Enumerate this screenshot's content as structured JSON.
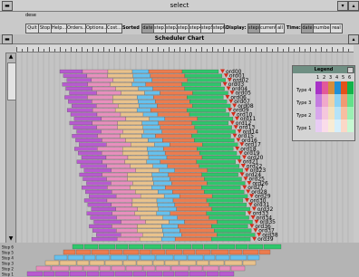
{
  "window": {
    "title": "select",
    "app_label": "dese"
  },
  "toolbar": {
    "buttons": [
      "Quit",
      "Stop",
      "Help...",
      "Orders...",
      "Options...",
      "Cost..."
    ],
    "sorted_by_label": "Sorted by:",
    "sort_options": [
      "date",
      "step1",
      "step2",
      "step3",
      "step4",
      "step5",
      "step6"
    ],
    "sort_selected": "date",
    "display_label": "Display:",
    "display_options": [
      "steps",
      "current",
      "all"
    ],
    "display_selected": "steps",
    "time_label": "Time:",
    "time_options": [
      "date",
      "number",
      "real"
    ],
    "time_selected": "date"
  },
  "chart_header": {
    "title": "Scheduler Chart"
  },
  "step_colors": [
    "#b85ad0",
    "#e88fbd",
    "#e9c28c",
    "#66c1ee",
    "#ec7c4e",
    "#2ec66b"
  ],
  "orders": {
    "labels": [
      "ord00",
      "ord01",
      "ord02",
      "ord03",
      "ord04",
      "ord05",
      "ord06",
      "ord07",
      "ord08",
      "ord09",
      "ord10",
      "ord11",
      "ord12",
      "ord13",
      "ord14",
      "ord15",
      "ord16",
      "ord17",
      "ord18",
      "ord19",
      "ord20",
      "ord21",
      "ord22",
      "ord23",
      "ord24",
      "ord25",
      "ord26",
      "ord27",
      "ord28",
      "ord29",
      "ord30",
      "ord31",
      "ord32",
      "ord33",
      "ord34",
      "ord35",
      "ord36",
      "ord37",
      "ord38",
      "ord39"
    ],
    "marker_color": "#d42a1a"
  },
  "legend": {
    "title": "Legend",
    "columns": [
      "1",
      "2",
      "3",
      "4",
      "5",
      "6"
    ],
    "rows": [
      "Type 4",
      "Type 3",
      "Type 2",
      "Type 1"
    ],
    "colors": [
      [
        "#a832c7",
        "#e2599a",
        "#d58d3b",
        "#1f8fd6",
        "#e3521a",
        "#12b34a"
      ],
      [
        "#c47de0",
        "#f0a9cb",
        "#eed2a6",
        "#8bd2f5",
        "#f09a73",
        "#63e08a"
      ],
      [
        "#d8a7ec",
        "#f5c7dd",
        "#f3e1bd",
        "#b5e3f8",
        "#f7bea1",
        "#9bf0b3"
      ],
      [
        "#e8ccf4",
        "#fadcea",
        "#f8ecd4",
        "#d5effb",
        "#fbd8c7",
        "#c7f8d2"
      ]
    ]
  },
  "bottom_rows": [
    "Step 6",
    "Step 5",
    "Step 4",
    "Step 3",
    "Step 2",
    "Step 1"
  ]
}
